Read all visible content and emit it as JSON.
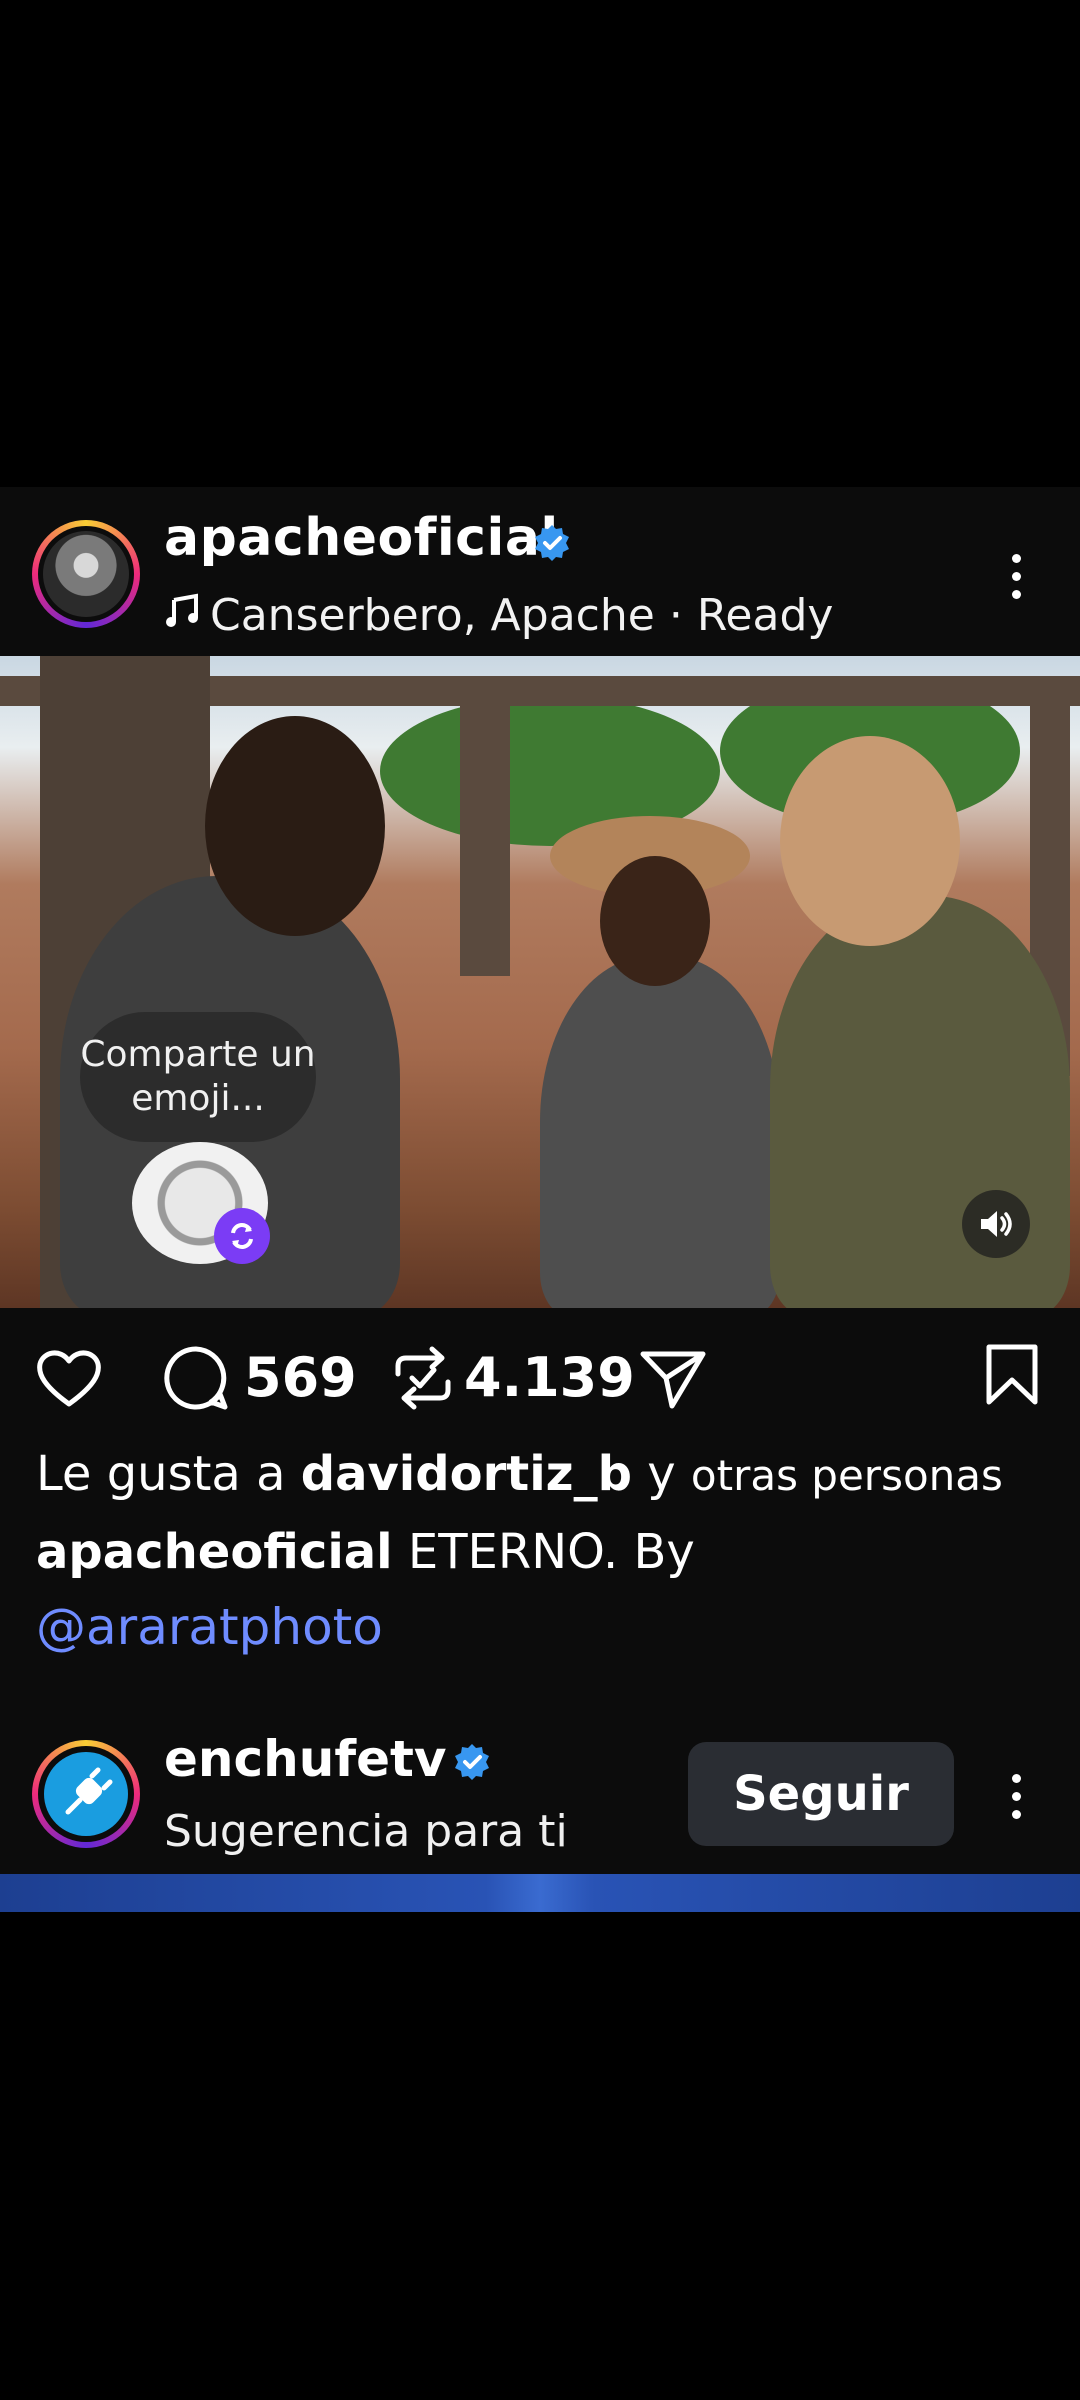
{
  "post": {
    "username": "apacheoficial",
    "verified": true,
    "music": {
      "artists": "Canserbero, Apache",
      "separator": "·",
      "track": "Ready"
    },
    "image_overlay": {
      "emoji_prompt": "Comparte un emoji..."
    },
    "actions": {
      "comments_count": "569",
      "reposts_count": "4.139"
    },
    "likes": {
      "prefix": "Le gusta a",
      "user": "davidortiz_b",
      "suffix_y": "y",
      "suffix_rest": "otras personas"
    },
    "caption": {
      "username": "apacheoficial",
      "text": "ETERNO. By",
      "mention": "@araratphoto"
    }
  },
  "suggestion": {
    "username": "enchufetv",
    "verified": true,
    "subtitle": "Sugerencia para ti",
    "follow_label": "Seguir"
  },
  "colors": {
    "background": "#000000",
    "verified_blue": "#3897f0",
    "mention_blue": "#6f8cff",
    "follow_button": "#2a2d33"
  }
}
